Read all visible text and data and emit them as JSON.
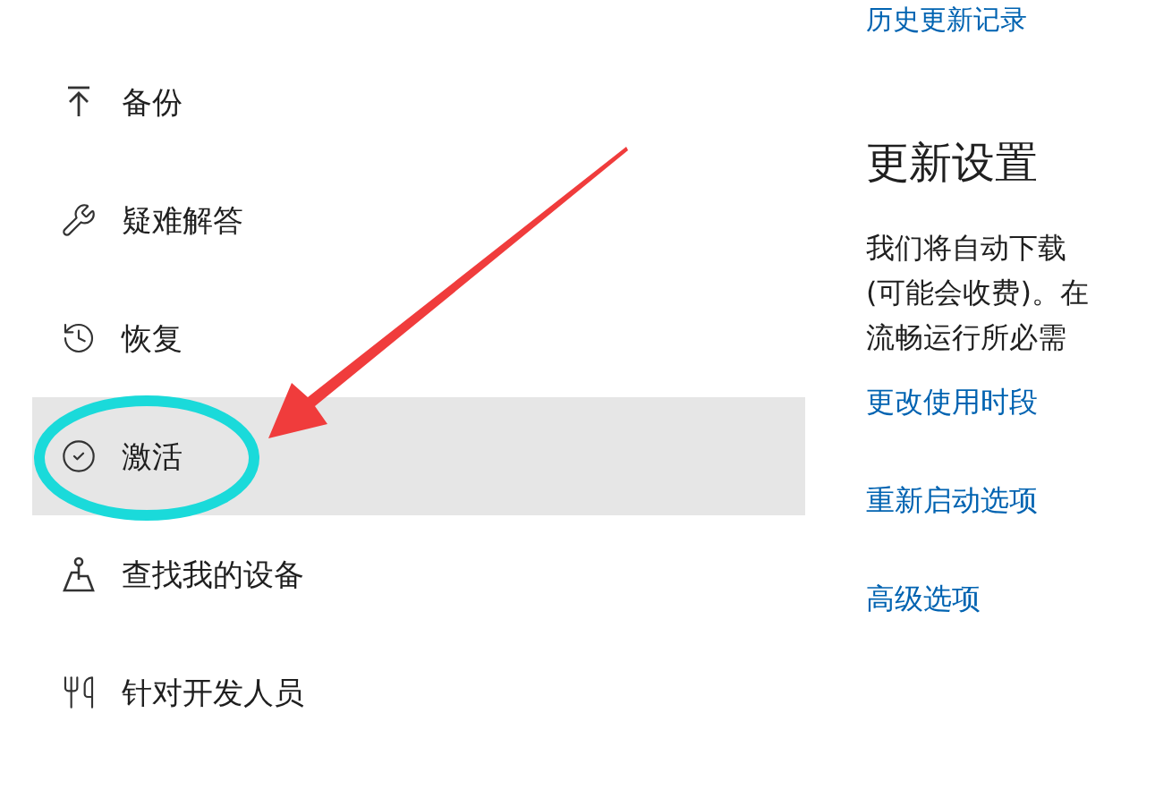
{
  "history_link": "历史更新记录",
  "sidebar": {
    "items": [
      {
        "label": "备份",
        "selected": false
      },
      {
        "label": "疑难解答",
        "selected": false
      },
      {
        "label": "恢复",
        "selected": false
      },
      {
        "label": "激活",
        "selected": true
      },
      {
        "label": "查找我的设备",
        "selected": false
      },
      {
        "label": "针对开发人员",
        "selected": false
      }
    ]
  },
  "update_settings": {
    "title": "更新设置",
    "description_lines": [
      "我们将自动下载",
      "(可能会收费)。在",
      "流畅运行所必需"
    ],
    "links": [
      "更改使用时段",
      "重新启动选项",
      "高级选项"
    ]
  }
}
